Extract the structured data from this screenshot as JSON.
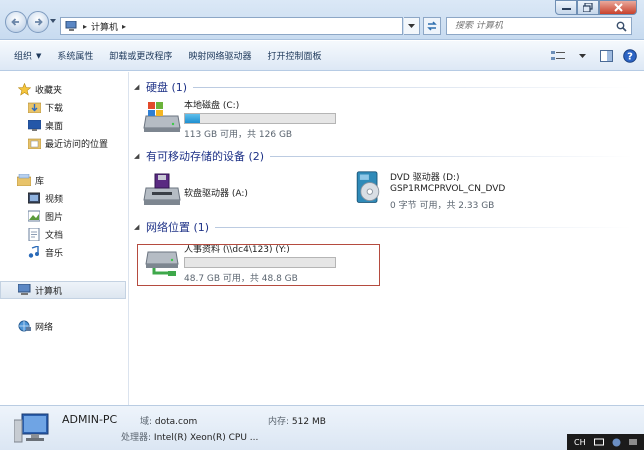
{
  "address": {
    "breadcrumb": "计算机",
    "search_placeholder": "搜索 计算机"
  },
  "toolbar": {
    "organize": "组织",
    "system_properties": "系统属性",
    "uninstall": "卸载或更改程序",
    "map_drive": "映射网络驱动器",
    "control_panel": "打开控制面板"
  },
  "sidebar": {
    "favorites": "收藏夹",
    "favorites_items": [
      "下载",
      "桌面",
      "最近访问的位置"
    ],
    "libraries": "库",
    "library_items": [
      "视频",
      "图片",
      "文档",
      "音乐"
    ],
    "computer": "计算机",
    "network": "网络"
  },
  "groups": {
    "hard_disk": "硬盘 (1)",
    "removable": "有可移动存储的设备 (2)",
    "network": "网络位置 (1)"
  },
  "drives": {
    "local_c": {
      "name": "本地磁盘 (C:)",
      "space": "113 GB 可用，共 126 GB",
      "used_fraction": 0.1
    },
    "floppy": {
      "name": "软盘驱动器 (A:)"
    },
    "dvd": {
      "name": "DVD 驱动器 (D:)",
      "label": "GSP1RMCPRVOL_CN_DVD",
      "space": "0 字节 可用，共 2.33 GB"
    },
    "net_y": {
      "name": "人事资料 (\\\\dc4\\123) (Y:)",
      "space": "48.7 GB 可用，共 48.8 GB",
      "used_fraction": 0.0
    }
  },
  "details": {
    "pc_name": "ADMIN-PC",
    "domain_label": "域:",
    "domain_value": "dota.com",
    "memory_label": "内存:",
    "memory_value": "512 MB",
    "cpu_label": "处理器:",
    "cpu_value": "Intel(R) Xeon(R) CPU ..."
  },
  "tray": {
    "lang": "CH"
  }
}
